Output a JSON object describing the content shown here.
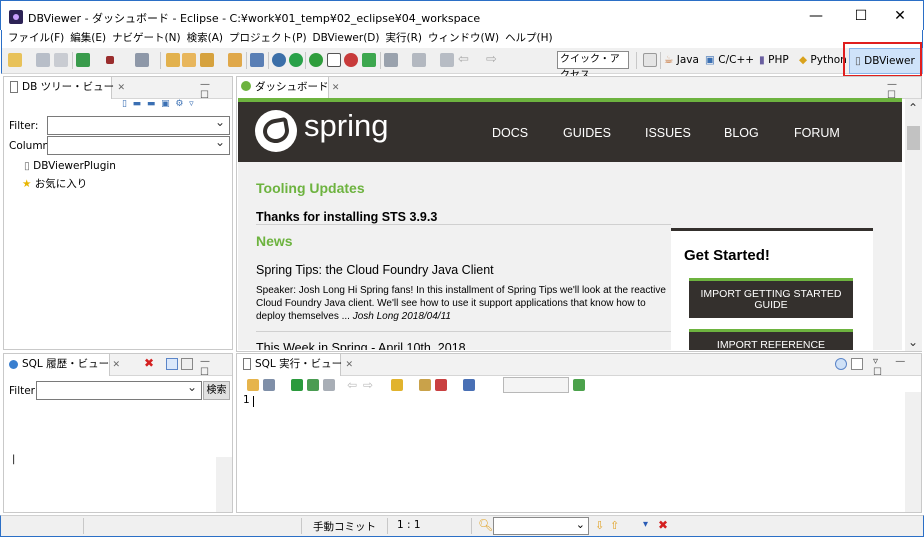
{
  "window": {
    "title": "DBViewer - ダッシュボード - Eclipse - C:¥work¥01_temp¥02_eclipse¥04_workspace",
    "minimize": "—",
    "maximize": "☐",
    "close": "✕"
  },
  "menu": [
    "ファイル(F)",
    "編集(E)",
    "ナビゲート(N)",
    "検索(A)",
    "プロジェクト(P)",
    "DBViewer(D)",
    "実行(R)",
    "ウィンドウ(W)",
    "ヘルプ(H)"
  ],
  "toolbar": {
    "quick_access": "クイック・アクセス",
    "perspectives": [
      "Java",
      "C/C++",
      "PHP",
      "Python",
      "DBViewer"
    ]
  },
  "dbtree": {
    "tab": "DB ツリー・ビュー",
    "filter_label": "Filter:",
    "column_label": "Column:",
    "items": [
      "DBViewerPlugin",
      "お気に入り"
    ]
  },
  "history": {
    "tab": "SQL 履歴・ビュー",
    "filter_label": "Filter:",
    "search_btn": "検索",
    "cursor": "|"
  },
  "dashboard": {
    "tab": "ダッシュボード",
    "logo": "spring",
    "nav": [
      "DOCS",
      "GUIDES",
      "ISSUES",
      "BLOG",
      "FORUM"
    ],
    "tooling_heading": "Tooling Updates",
    "thanks": "Thanks for installing STS 3.9.3",
    "news_heading": "News",
    "article_title": "Spring Tips: the Cloud Foundry Java Client",
    "article_body": "Speaker: Josh Long Hi Spring fans! In this installment of Spring Tips we'll look at the reactive Cloud Foundry Java client. We'll see how to use it support applications that know how to deploy themselves ...",
    "article_meta": "Josh Long 2018/04/11",
    "next_article": "This Week in Spring - April 10th, 2018",
    "get_started": "Get Started!",
    "btn1": "IMPORT GETTING STARTED GUIDE",
    "btn2": "IMPORT REFERENCE"
  },
  "sqlexec": {
    "tab": "SQL 実行・ビュー",
    "line_no": "1"
  },
  "status": {
    "commit": "手動コミット",
    "position": "1 : 1"
  },
  "colors": {
    "spring_green": "#6db33f",
    "spring_dark": "#34302d",
    "accent": "#2b6fc6",
    "highlight": "#e01e1e"
  }
}
